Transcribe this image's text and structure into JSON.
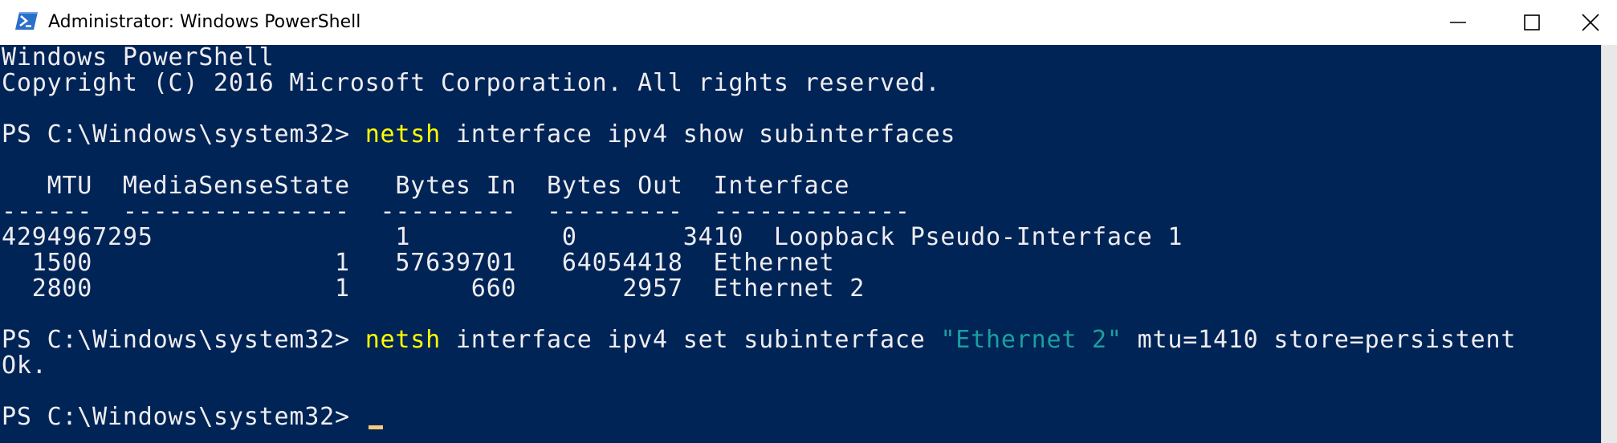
{
  "window": {
    "title": "Administrator: Windows PowerShell",
    "icon": "powershell-icon",
    "controls": [
      "minimize-icon",
      "maximize-icon",
      "close-icon"
    ]
  },
  "colors": {
    "console_bg": "#012456",
    "text": "#eeedf0",
    "command": "#ffff00",
    "string": "#1a9fa0",
    "cursor": "#feca7a"
  },
  "console": {
    "banner_line1": "Windows PowerShell",
    "banner_line2": "Copyright (C) 2016 Microsoft Corporation. All rights reserved.",
    "prompt": "PS C:\\Windows\\system32> ",
    "cmd1": {
      "command": "netsh",
      "args": " interface ipv4 show subinterfaces"
    },
    "table": {
      "header": "   MTU  MediaSenseState   Bytes In  Bytes Out  Interface",
      "divider": "------  ---------------  ---------  ---------  -------------",
      "rows": [
        "4294967295                1          0       3410  Loopback Pseudo-Interface 1",
        "  1500                1   57639701   64054418  Ethernet",
        "  2800                1        660       2957  Ethernet 2"
      ]
    },
    "cmd2": {
      "command": "netsh",
      "args_before": " interface ipv4 set subinterface ",
      "string_arg": "\"Ethernet 2\"",
      "args_after": " mtu=1410 store=persistent"
    },
    "result": "Ok."
  }
}
